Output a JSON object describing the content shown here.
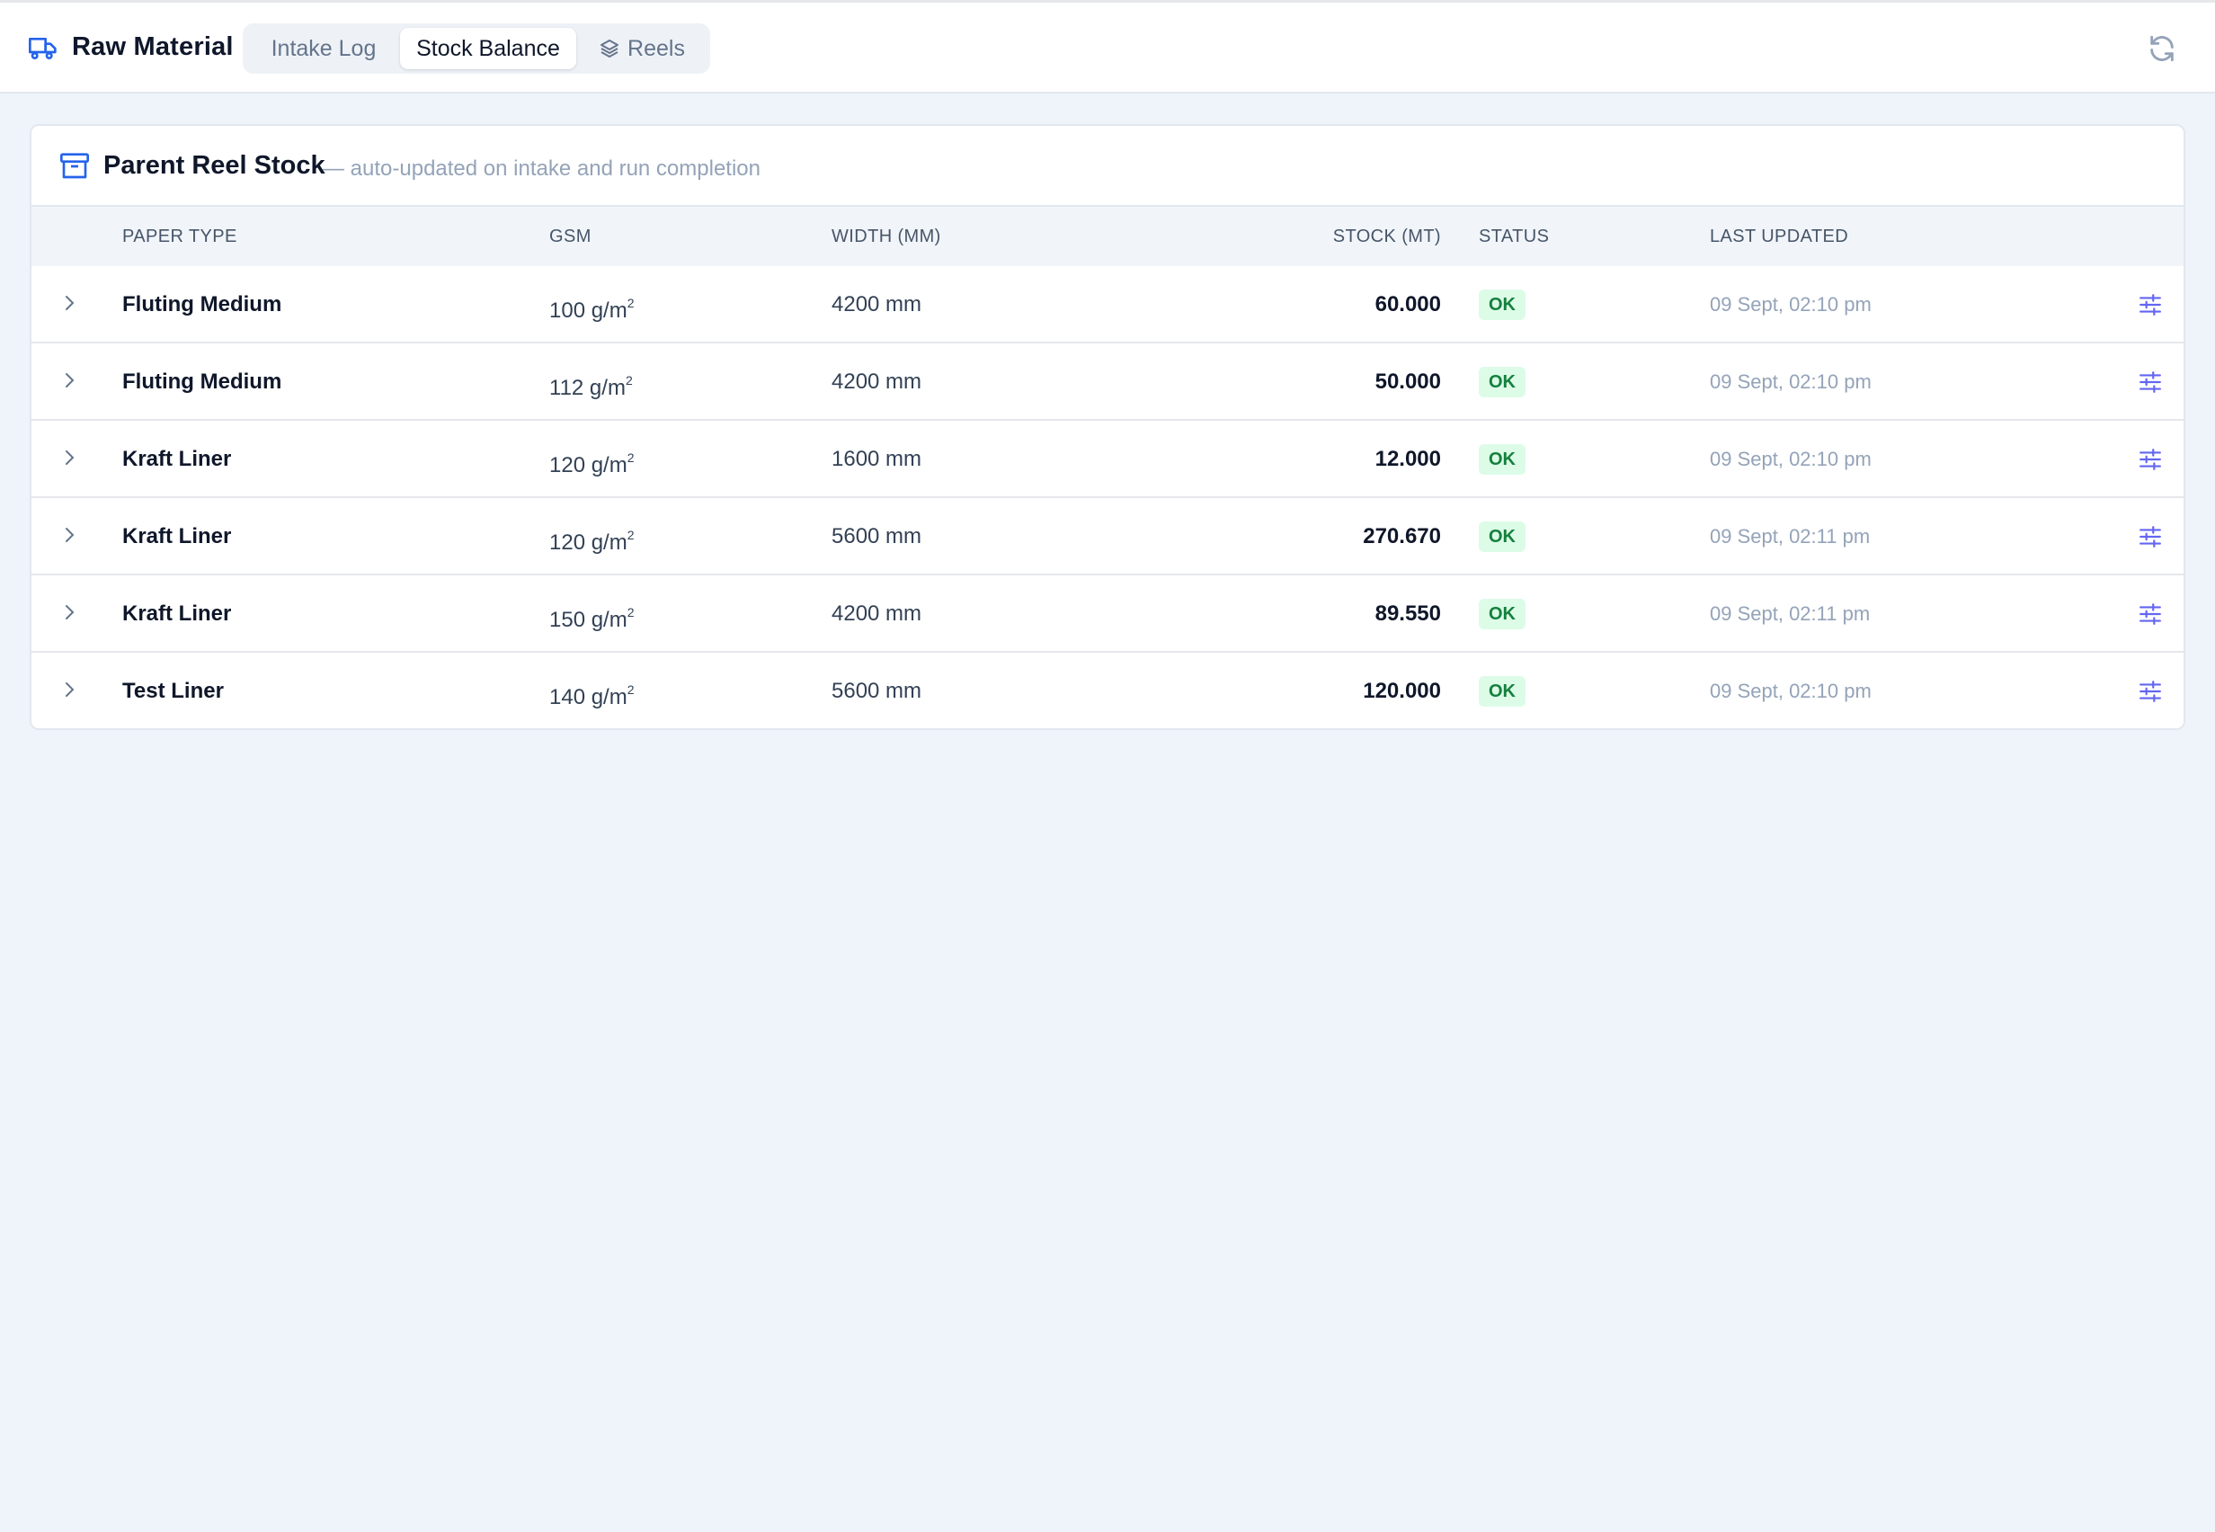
{
  "app": {
    "title": "Raw Material"
  },
  "tabs": [
    {
      "label": "Intake Log",
      "active": false
    },
    {
      "label": "Stock Balance",
      "active": true
    },
    {
      "label": "Reels",
      "active": false
    }
  ],
  "card": {
    "title": "Parent Reel Stock",
    "subtitle": "— auto-updated on intake and run completion"
  },
  "table": {
    "columns": [
      "Paper Type",
      "GSM",
      "Width (mm)",
      "Stock (MT)",
      "Status",
      "Last Updated"
    ],
    "rows": [
      {
        "type": "Fluting Medium",
        "gsm": "100 g/m",
        "width": "4200 mm",
        "stock": "60.000",
        "status": "OK",
        "updated": "09 Sept, 02:10 pm"
      },
      {
        "type": "Fluting Medium",
        "gsm": "112 g/m",
        "width": "4200 mm",
        "stock": "50.000",
        "status": "OK",
        "updated": "09 Sept, 02:10 pm"
      },
      {
        "type": "Kraft Liner",
        "gsm": "120 g/m",
        "width": "1600 mm",
        "stock": "12.000",
        "status": "OK",
        "updated": "09 Sept, 02:10 pm"
      },
      {
        "type": "Kraft Liner",
        "gsm": "120 g/m",
        "width": "5600 mm",
        "stock": "270.670",
        "status": "OK",
        "updated": "09 Sept, 02:11 pm"
      },
      {
        "type": "Kraft Liner",
        "gsm": "150 g/m",
        "width": "4200 mm",
        "stock": "89.550",
        "status": "OK",
        "updated": "09 Sept, 02:11 pm"
      },
      {
        "type": "Test Liner",
        "gsm": "140 g/m",
        "width": "5600 mm",
        "stock": "120.000",
        "status": "OK",
        "updated": "09 Sept, 02:10 pm"
      }
    ]
  },
  "icons": {
    "brand": "truck-icon",
    "card": "archive-icon",
    "reels_tab": "layers-icon",
    "refresh": "refresh-icon",
    "expand": "chevron-right-icon",
    "row_action": "sliders-icon"
  },
  "colors": {
    "accent": "#2563eb",
    "status_ok_bg": "#dcfce7",
    "status_ok_text": "#15803d",
    "action_icon": "#6366f1"
  }
}
